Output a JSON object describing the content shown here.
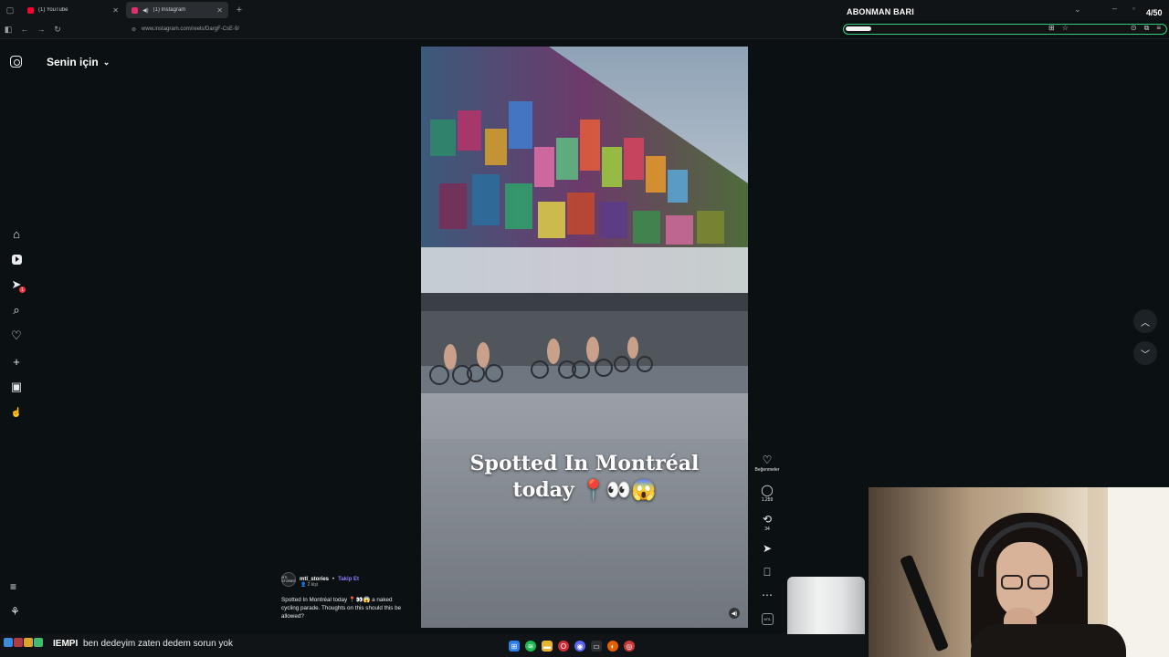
{
  "browser": {
    "tabs": [
      {
        "title": "(1) YouTube",
        "favicon_color": "#ff0033",
        "active": false
      },
      {
        "title": "(1) Instagram",
        "favicon_color": "#e1306c",
        "active": true
      }
    ],
    "url_host": "www.instagram.com",
    "url_path": "/reels/DargF-CsE-9/"
  },
  "subscription_overlay": {
    "title": "ABONMAN BARI",
    "count": "4/50",
    "progress_fraction": 0.08,
    "accent_color": "#2fd17a"
  },
  "instagram": {
    "feed_title": "Senin için",
    "nav_icons": [
      "home-icon",
      "reels-icon",
      "messages-icon",
      "search-icon",
      "notifications-icon",
      "create-icon",
      "dashboard-icon",
      "profile-icon"
    ],
    "notification_badge": "1",
    "reel": {
      "caption_line1": "Spotted In Montréal",
      "caption_line2": "today 📍👀😱",
      "author": "mtl_stories",
      "separator": "•",
      "follow_label": "Takip Et",
      "collab": "2 kişi",
      "avatar_text": "MTL STORIES",
      "description": "Spotted In Montréal today 📍👀😱 a naked cycling parade. Thoughts on this should this be allowed?",
      "likes_label": "Beğenmeler",
      "comments": "1.259",
      "reposts": "34",
      "audio_label": "MTL"
    }
  },
  "chat": {
    "user": "IEMPI",
    "message": "ben dedeyim zaten dedem sorun yok"
  }
}
